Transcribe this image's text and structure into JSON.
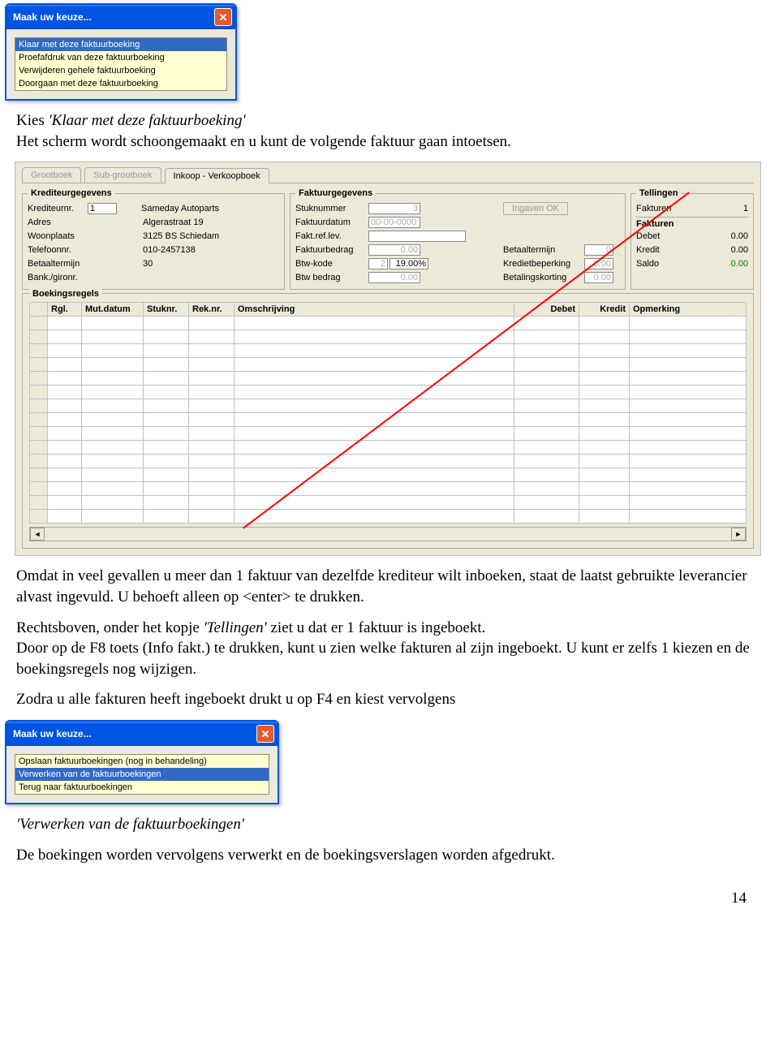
{
  "dialog1": {
    "title": "Maak uw keuze...",
    "items": [
      "Klaar met deze faktuurboeking",
      "Proefafdruk van deze faktuurboeking",
      "Verwijderen gehele faktuurboeking",
      "Doorgaan met deze faktuurboeking"
    ],
    "selected_index": 0
  },
  "para1a": "Kies ",
  "para1b": "'Klaar met deze faktuurboeking'",
  "para1c": "Het scherm wordt schoongemaakt en u kunt de volgende faktuur gaan intoetsen.",
  "panel": {
    "tabs": [
      "Grootboek",
      "Sub-grootboek",
      "Inkoop - Verkoopboek"
    ],
    "active_tab": 2,
    "krediteur": {
      "legend": "Krediteurgegevens",
      "labels": {
        "nr": "Krediteurnr.",
        "adres": "Adres",
        "woonplaats": "Woonplaats",
        "telefoon": "Telefoonnr.",
        "betaaltermijn": "Betaaltermijn",
        "bank": "Bank./gironr."
      },
      "values": {
        "nr": "1",
        "naam": "Sameday Autoparts",
        "adres": "Algerastraat 19",
        "woonplaats": "3125 BS  Schiedam",
        "telefoon": "010-2457138",
        "betaaltermijn": "30",
        "bank": ""
      }
    },
    "faktuur": {
      "legend": "Faktuurgegevens",
      "labels": {
        "stuknummer": "Stuknummer",
        "faktuurdatum": "Faktuurdatum",
        "faktreflev": "Fakt.ref.lev.",
        "faktuurbedrag": "Faktuurbedrag",
        "btwkode": "Btw-kode",
        "btwbedrag": "Btw bedrag",
        "betaaltermijn": "Betaaltermijn",
        "kredietbeperking": "Kredietbeperking",
        "betalingskorting": "Betalingskorting"
      },
      "values": {
        "stuknummer": "3",
        "faktuurdatum": "00-00-0000",
        "faktreflev": "",
        "faktuurbedrag": "0.00",
        "btwkode": "2",
        "btwpct": "19.00%",
        "btwbedrag": "0.00",
        "betaaltermijn": "0",
        "kredietbeperking": "0.00",
        "betalingskorting": "0.00"
      },
      "button": "Ingaven OK"
    },
    "tellingen": {
      "legend": "Tellingen",
      "fakturen_label": "Fakturen",
      "fakturen_value": "1",
      "sublegend": "Fakturen",
      "debet_label": "Debet",
      "debet": "0.00",
      "kredit_label": "Kredit",
      "kredit": "0.00",
      "saldo_label": "Saldo",
      "saldo": "0.00"
    },
    "boekings": {
      "legend": "Boekingsregels",
      "cols": [
        "Rgl.",
        "Mut.datum",
        "Stuknr.",
        "Rek.nr.",
        "Omschrijving",
        "Debet",
        "Kredit",
        "Opmerking"
      ]
    }
  },
  "para2": "Omdat in veel gevallen u meer dan 1 faktuur van dezelfde krediteur wilt inboeken, staat de laatst gebruikte leverancier alvast ingevuld. U behoeft alleen op <enter> te drukken.",
  "para3a": "Rechtsboven, onder het kopje ",
  "para3b": "'Tellingen'",
  "para3c": " ziet u dat er 1 faktuur is ingeboekt.",
  "para4": "Door op de F8 toets (Info fakt.) te drukken, kunt u zien welke fakturen al zijn ingeboekt. U kunt er zelfs 1 kiezen en de boekingsregels nog wijzigen.",
  "para5": "Zodra u alle fakturen heeft ingeboekt drukt u op F4 en kiest vervolgens",
  "dialog2": {
    "title": "Maak uw keuze...",
    "items": [
      "Opslaan faktuurboekingen (nog in behandeling)",
      "Verwerken van de faktuurboekingen",
      "Terug naar faktuurboekingen"
    ],
    "selected_index": 1
  },
  "para6a": "'Verwerken van de faktuurboekingen'",
  "para7": "De boekingen worden vervolgens verwerkt en de boekingsverslagen worden afgedrukt.",
  "pagenum": "14"
}
